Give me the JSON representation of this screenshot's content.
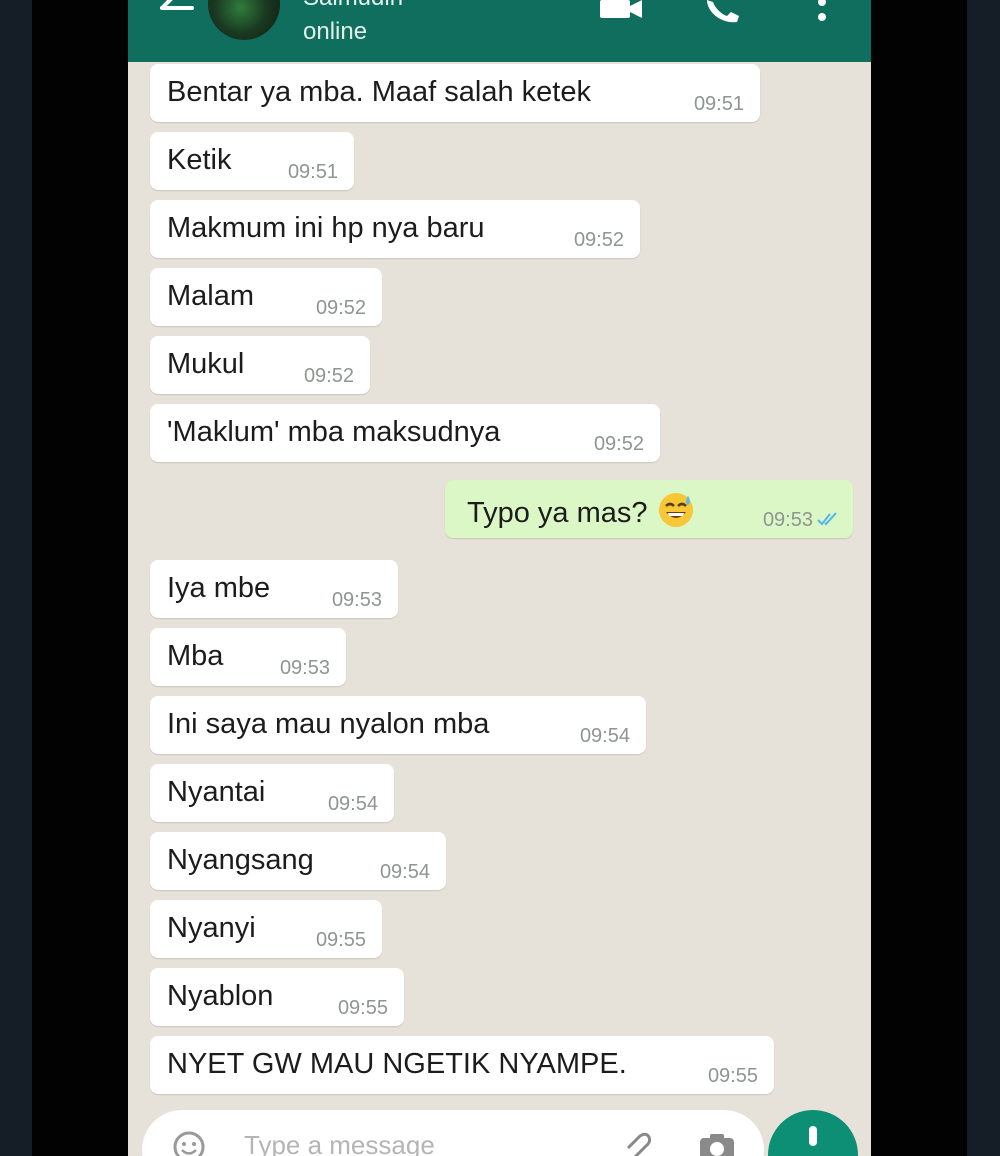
{
  "header": {
    "contact_name": "Saimudin",
    "status": "online"
  },
  "messages": [
    {
      "text": "Bentar ya mba. Maaf salah ketek",
      "time": "09:51",
      "direction": "in"
    },
    {
      "text": "Ketik",
      "time": "09:51",
      "direction": "in"
    },
    {
      "text": "Makmum ini hp nya baru",
      "time": "09:52",
      "direction": "in"
    },
    {
      "text": "Malam",
      "time": "09:52",
      "direction": "in"
    },
    {
      "text": "Mukul",
      "time": "09:52",
      "direction": "in"
    },
    {
      "text": "'Maklum' mba maksudnya",
      "time": "09:52",
      "direction": "in"
    },
    {
      "text": "Typo ya mas?",
      "time": "09:53",
      "direction": "out",
      "emoji": "grinning-sweat-emoji",
      "read": true
    },
    {
      "text": "Iya mbe",
      "time": "09:53",
      "direction": "in"
    },
    {
      "text": "Mba",
      "time": "09:53",
      "direction": "in"
    },
    {
      "text": "Ini saya mau nyalon mba",
      "time": "09:54",
      "direction": "in"
    },
    {
      "text": "Nyantai",
      "time": "09:54",
      "direction": "in"
    },
    {
      "text": "Nyangsang",
      "time": "09:54",
      "direction": "in"
    },
    {
      "text": "Nyanyi",
      "time": "09:55",
      "direction": "in"
    },
    {
      "text": "Nyablon",
      "time": "09:55",
      "direction": "in"
    },
    {
      "text": "NYET GW MAU NGETIK NYAMPE.",
      "time": "09:55",
      "direction": "in"
    }
  ],
  "composer": {
    "placeholder": "Type a message"
  },
  "colors": {
    "header": "#0f6e5e",
    "chat_background": "#e6e1d9",
    "outgoing_bubble": "#dcf7c6",
    "incoming_bubble": "#ffffff",
    "read_ticks": "#4fb6ec",
    "mic_button": "#0c8f75"
  },
  "icons": [
    "back-arrow-icon",
    "video-call-icon",
    "phone-icon",
    "more-vert-icon",
    "emoji-icon",
    "attach-icon",
    "camera-icon",
    "mic-icon"
  ]
}
